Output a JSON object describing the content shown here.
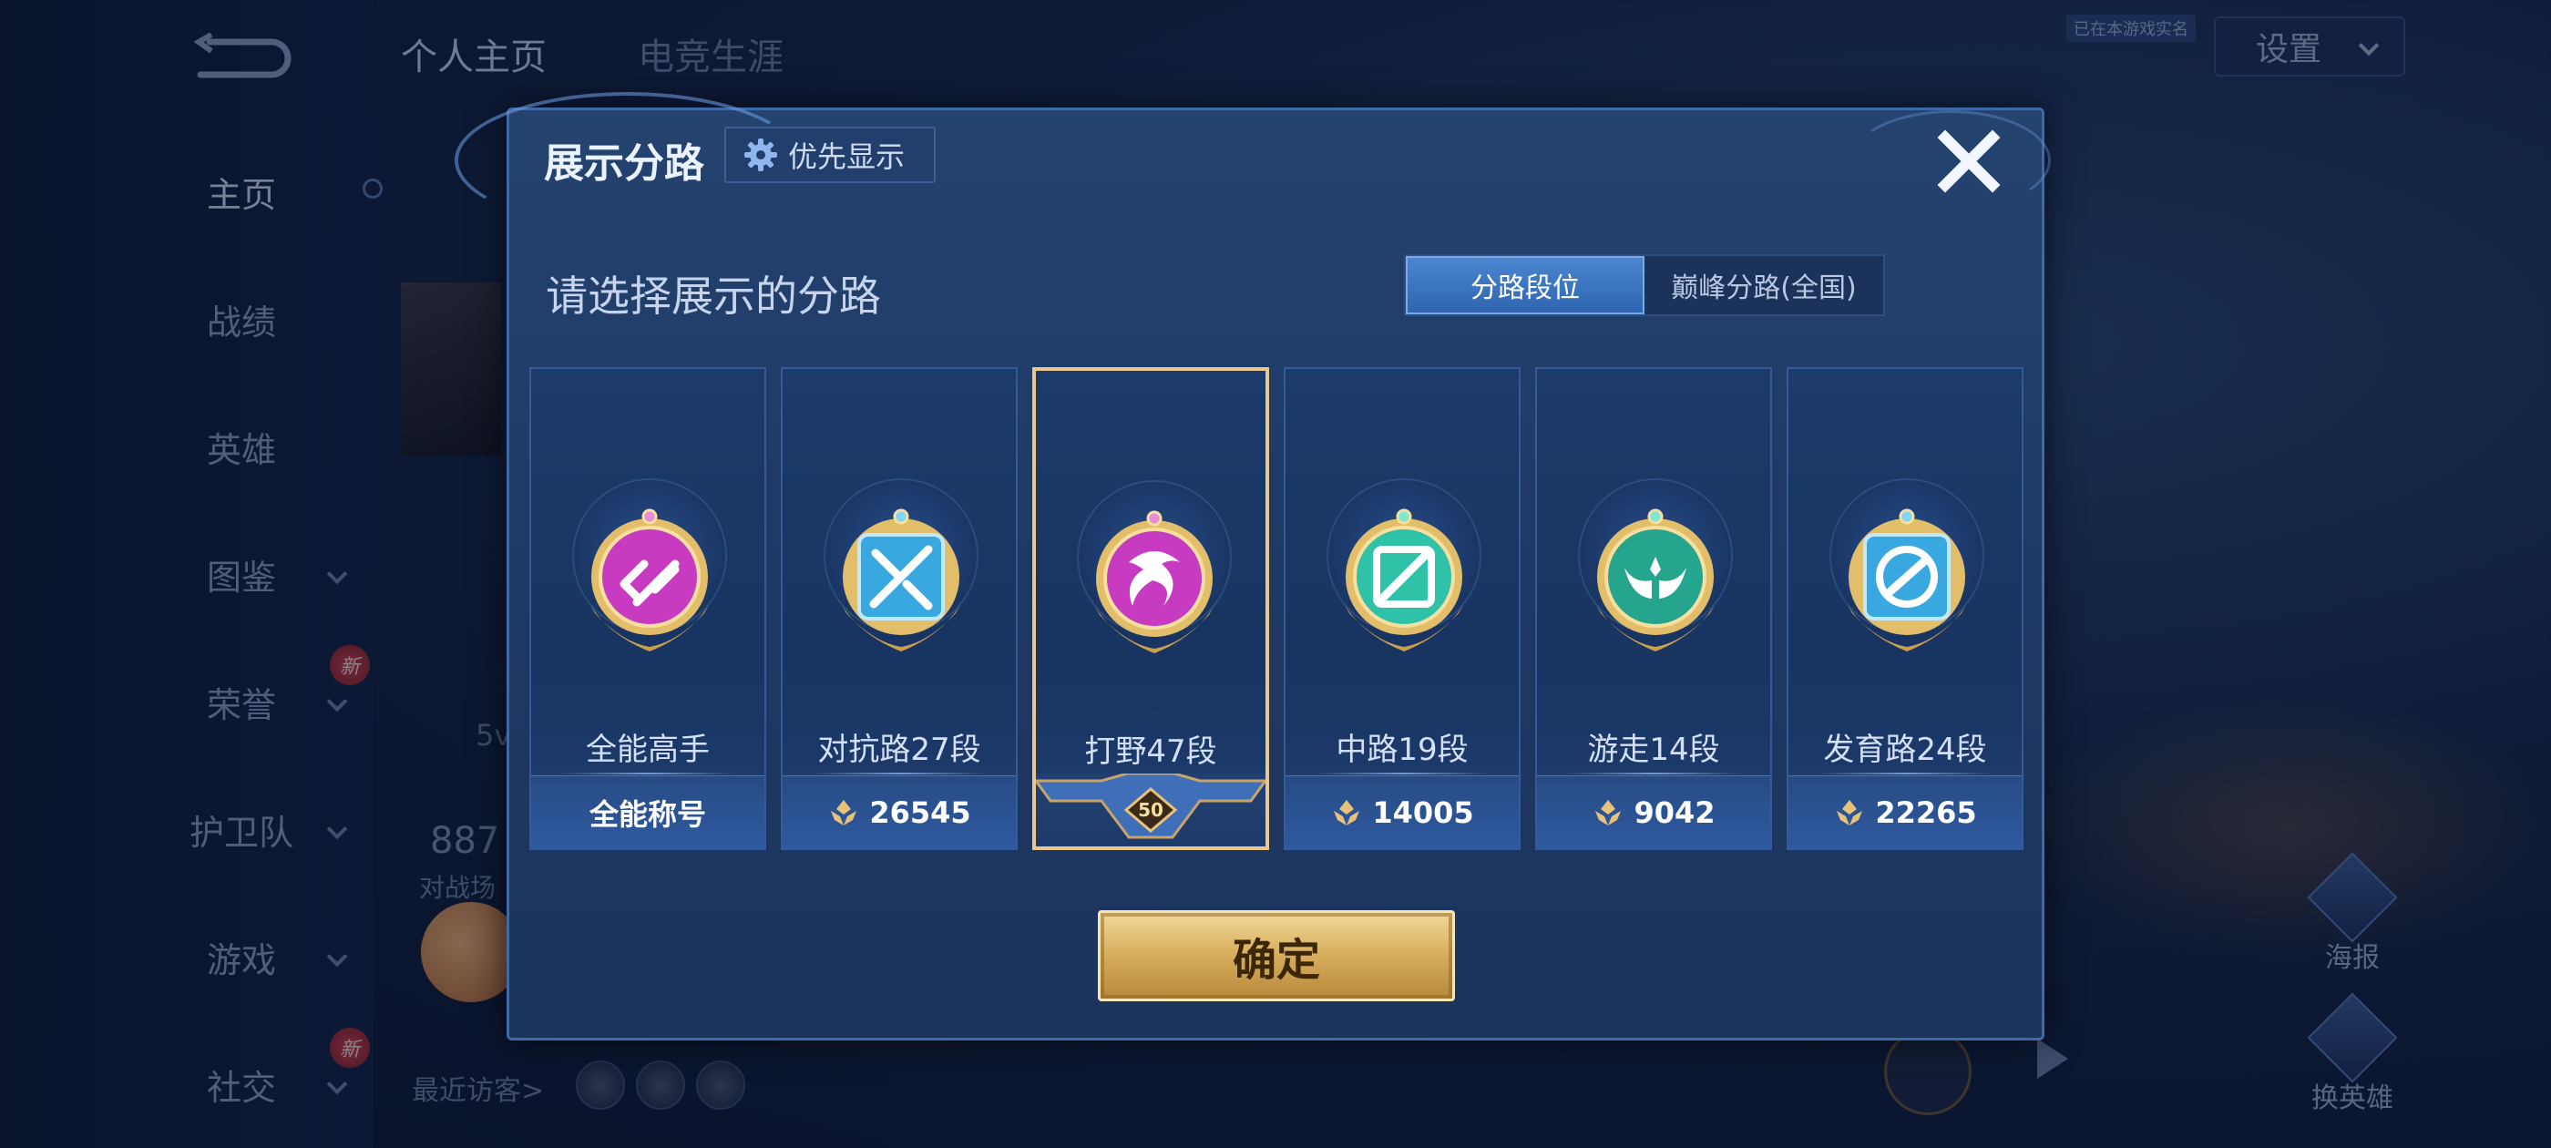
{
  "background": {
    "nav_items": [
      {
        "label": "主页",
        "has_chevron": false,
        "active": true
      },
      {
        "label": "战绩",
        "has_chevron": false
      },
      {
        "label": "英雄",
        "has_chevron": false
      },
      {
        "label": "图鉴",
        "has_chevron": true
      },
      {
        "label": "荣誉",
        "has_chevron": true,
        "new_badge": true
      },
      {
        "label": "护卫队",
        "has_chevron": true
      },
      {
        "label": "游戏",
        "has_chevron": true
      },
      {
        "label": "社交",
        "has_chevron": true,
        "new_badge": true
      }
    ],
    "new_badge_label": "新",
    "top_tabs": [
      "个人主页",
      "电竞生涯"
    ],
    "settings_label": "设置",
    "real_name_tag": "已在本游戏实名",
    "left_5v": "5v",
    "stat_value": "887",
    "stat_caption": "对战场",
    "recent_visitors_label": "最近访客>",
    "right_buttons": {
      "poster": "海报",
      "switch_hero": "换英雄"
    }
  },
  "modal": {
    "title": "展示分路",
    "priority_button_label": "优先显示",
    "subtitle": "请选择展示的分路",
    "toggle": {
      "options": [
        "分路段位",
        "巅峰分路(全国)"
      ],
      "selected": "分路段位"
    },
    "cards": [
      {
        "role": "全能高手",
        "footer": "全能称号",
        "footer_type": "text",
        "medal_color": "#c63bc0",
        "medal_icon": "allround-icon"
      },
      {
        "role": "对抗路27段",
        "footer": "26545",
        "footer_type": "points",
        "medal_color": "#3aa8e0",
        "medal_icon": "clash-lane-icon"
      },
      {
        "role": "打野47段",
        "footer": "50",
        "footer_type": "tier",
        "medal_color": "#c63bc0",
        "medal_icon": "jungle-dragon-icon",
        "selected": true
      },
      {
        "role": "中路19段",
        "footer": "14005",
        "footer_type": "points",
        "medal_color": "#2fc2a8",
        "medal_icon": "mid-lane-icon"
      },
      {
        "role": "游走14段",
        "footer": "9042",
        "footer_type": "points",
        "medal_color": "#26a58e",
        "medal_icon": "roam-wings-icon"
      },
      {
        "role": "发育路24段",
        "footer": "22265",
        "footer_type": "points",
        "medal_color": "#3aa8e0",
        "medal_icon": "farm-lane-icon"
      }
    ],
    "confirm_label": "确定"
  }
}
